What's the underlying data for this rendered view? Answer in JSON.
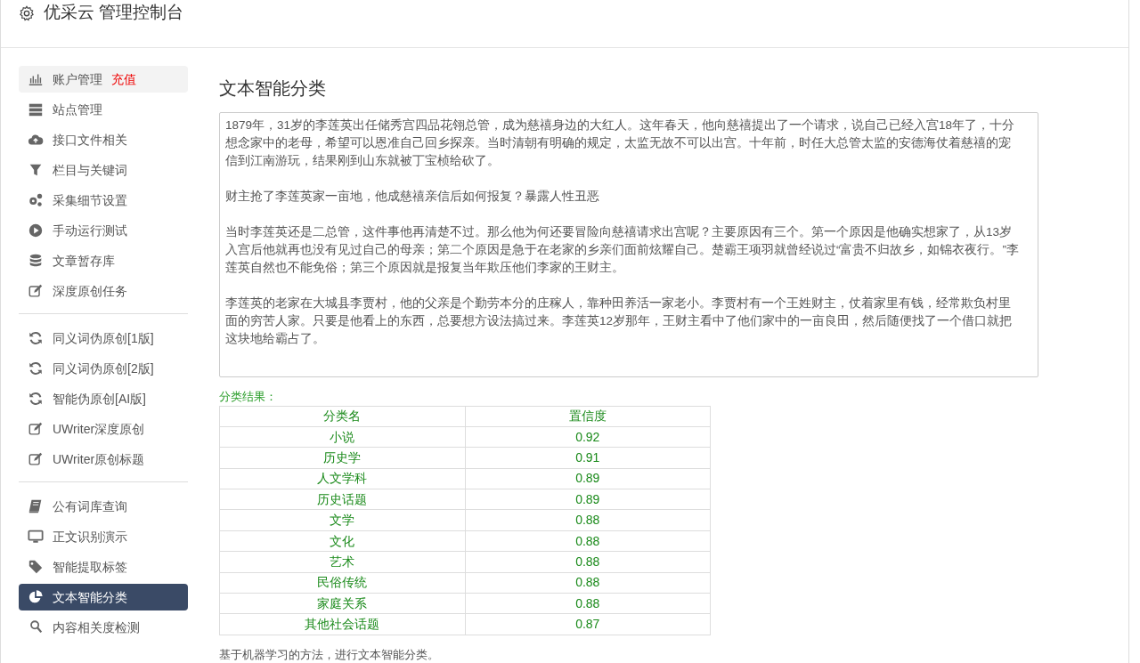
{
  "header": {
    "title": "优采云 管理控制台"
  },
  "sidebar": {
    "groups": [
      {
        "items": [
          {
            "label": "账户管理",
            "badge": "充值",
            "selected": false,
            "hover": true
          },
          {
            "label": "站点管理",
            "selected": false
          },
          {
            "label": "接口文件相关",
            "selected": false
          },
          {
            "label": "栏目与关键词",
            "selected": false
          },
          {
            "label": "采集细节设置",
            "selected": false
          },
          {
            "label": "手动运行测试",
            "selected": false
          },
          {
            "label": "文章暂存库",
            "selected": false
          },
          {
            "label": "深度原创任务",
            "selected": false
          }
        ]
      },
      {
        "items": [
          {
            "label": "同义词伪原创[1版]",
            "selected": false
          },
          {
            "label": "同义词伪原创[2版]",
            "selected": false
          },
          {
            "label": "智能伪原创[AI版]",
            "selected": false
          },
          {
            "label": "UWriter深度原创",
            "selected": false
          },
          {
            "label": "UWriter原创标题",
            "selected": false
          }
        ]
      },
      {
        "items": [
          {
            "label": "公有词库查询",
            "selected": false
          },
          {
            "label": "正文识别演示",
            "selected": false
          },
          {
            "label": "智能提取标签",
            "selected": false
          },
          {
            "label": "文本智能分类",
            "selected": true
          },
          {
            "label": "内容相关度检测",
            "selected": false
          }
        ]
      }
    ]
  },
  "main": {
    "title": "文本智能分类",
    "input_paragraphs": [
      "1879年，31岁的李莲英出任储秀宫四品花翎总管，成为慈禧身边的大红人。这年春天，他向慈禧提出了一个请求，说自己已经入宫18年了，十分想念家中的老母，希望可以恩准自己回乡探亲。当时清朝有明确的规定，太监无故不可以出宫。十年前，时任大总管太监的安德海仗着慈禧的宠信到江南游玩，结果刚到山东就被丁宝桢给砍了。",
      "财主抢了李莲英家一亩地，他成慈禧亲信后如何报复？暴露人性丑恶",
      "当时李莲英还是二总管，这件事他再清楚不过。那么他为何还要冒险向慈禧请求出宫呢？主要原因有三个。第一个原因是他确实想家了，从13岁入宫后他就再也没有见过自己的母亲；第二个原因是急于在老家的乡亲们面前炫耀自己。楚霸王项羽就曾经说过“富贵不归故乡，如锦衣夜行。”李莲英自然也不能免俗；第三个原因就是报复当年欺压他们李家的王财主。",
      "李莲英的老家在大城县李贾村，他的父亲是个勤劳本分的庄稼人，靠种田养活一家老小。李贾村有一个王姓财主，仗着家里有钱，经常欺负村里面的穷苦人家。只要是他看上的东西，总要想方设法搞过来。李莲英12岁那年，王财主看中了他们家中的一亩良田，然后随便找了一个借口就把这块地给霸占了。"
    ],
    "result_label": "分类结果：",
    "table": {
      "columns": [
        "分类名",
        "置信度"
      ],
      "rows": [
        [
          "小说",
          "0.92"
        ],
        [
          "历史学",
          "0.91"
        ],
        [
          "人文学科",
          "0.89"
        ],
        [
          "历史话题",
          "0.89"
        ],
        [
          "文学",
          "0.88"
        ],
        [
          "文化",
          "0.88"
        ],
        [
          "艺术",
          "0.88"
        ],
        [
          "民俗传统",
          "0.88"
        ],
        [
          "家庭关系",
          "0.88"
        ],
        [
          "其他社会话题",
          "0.87"
        ]
      ]
    },
    "description": "基于机器学习的方法，进行文本智能分类。"
  }
}
